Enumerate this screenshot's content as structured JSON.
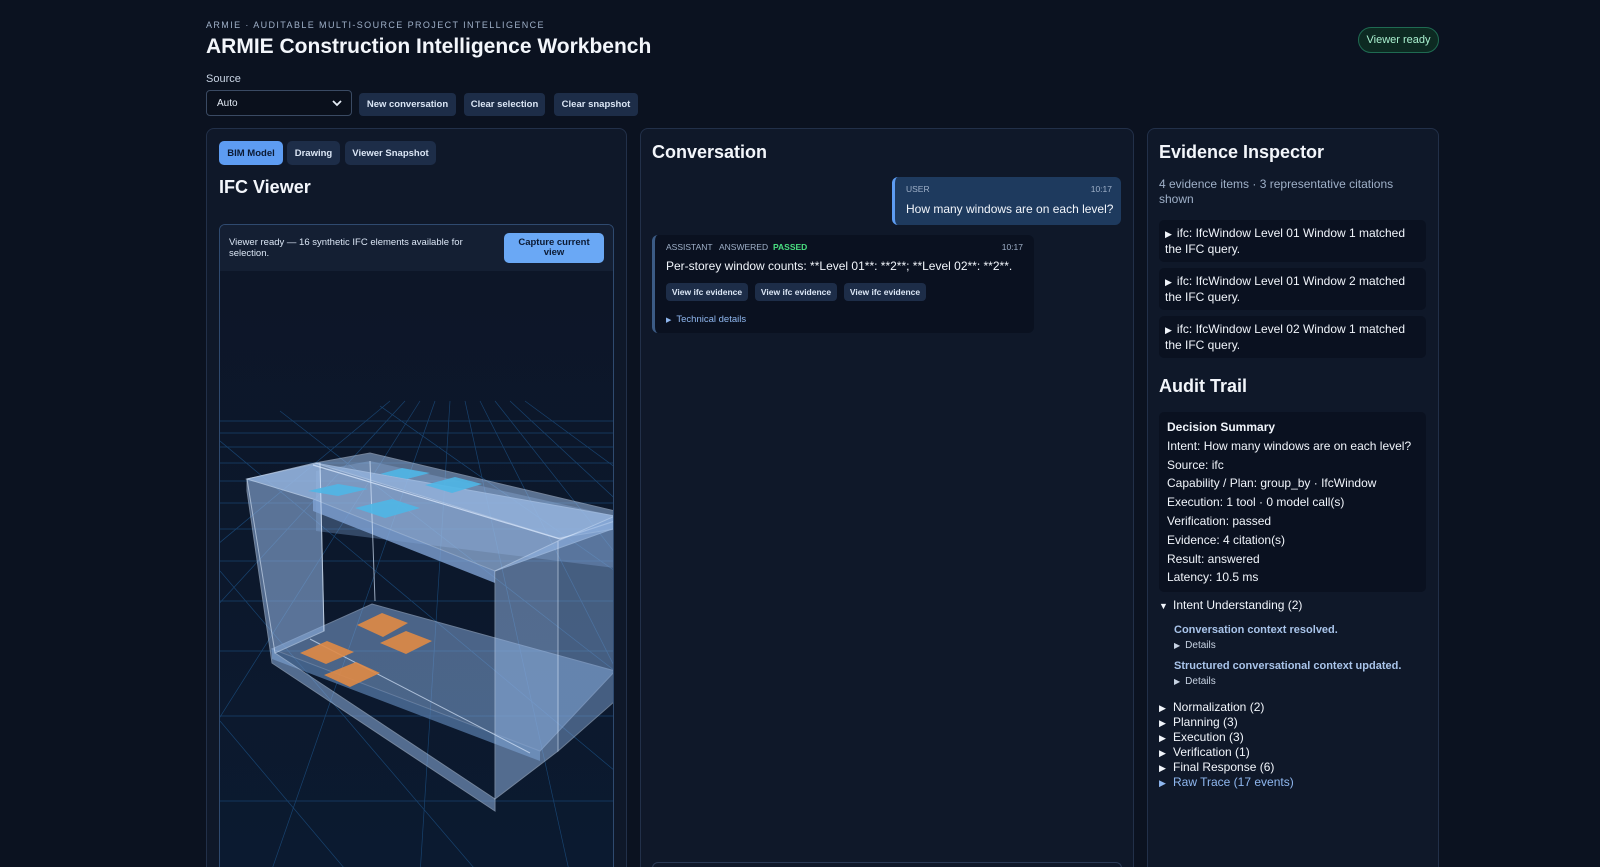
{
  "header": {
    "eyebrow": "ARMIE · AUDITABLE MULTI-SOURCE PROJECT INTELLIGENCE",
    "title": "ARMIE Construction Intelligence Workbench",
    "status": "Viewer ready"
  },
  "toolbar": {
    "source_label": "Source",
    "source_value": "Auto",
    "new_conversation": "New conversation",
    "clear_selection": "Clear selection",
    "clear_snapshot": "Clear snapshot"
  },
  "left_panel": {
    "tabs": [
      {
        "label": "BIM Model",
        "active": true
      },
      {
        "label": "Drawing",
        "active": false
      },
      {
        "label": "Viewer Snapshot",
        "active": false
      }
    ],
    "title": "IFC Viewer",
    "viewer_message": "Viewer ready — 16 synthetic IFC elements available for selection.",
    "capture_button": "Capture current view"
  },
  "conversation": {
    "title": "Conversation",
    "user_message": {
      "role": "USER",
      "time": "10:17",
      "text": "How many windows are on each level?"
    },
    "assistant_message": {
      "role": "ASSISTANT",
      "status": "ANSWERED",
      "verification": "PASSED",
      "time": "10:17",
      "text": "Per-storey window counts: **Level 01**: **2**; **Level 02**: **2**.",
      "evidence_buttons": [
        "View ifc evidence",
        "View ifc evidence",
        "View ifc evidence"
      ],
      "technical_details": "Technical details"
    }
  },
  "evidence": {
    "title": "Evidence Inspector",
    "summary": "4 evidence items · 3 representative citations shown",
    "citations": [
      "ifc: IfcWindow Level 01 Window 1 matched the IFC query.",
      "ifc: IfcWindow Level 01 Window 2 matched the IFC query.",
      "ifc: IfcWindow Level 02 Window 1 matched the IFC query."
    ]
  },
  "audit": {
    "title": "Audit Trail",
    "decision_summary": {
      "heading": "Decision Summary",
      "lines": [
        "Intent: How many windows are on each level?",
        "Source: ifc",
        "Capability / Plan: group_by · IfcWindow",
        "Execution: 1 tool · 0 model call(s)",
        "Verification: passed",
        "Evidence: 4 citation(s)",
        "Result: answered",
        "Latency: 10.5 ms"
      ]
    },
    "intent_section": {
      "label": "Intent Understanding (2)",
      "items": [
        {
          "title": "Conversation context resolved.",
          "details": "Details"
        },
        {
          "title": "Structured conversational context updated.",
          "details": "Details"
        }
      ]
    },
    "sections": [
      "Normalization (2)",
      "Planning (3)",
      "Execution (3)",
      "Verification (1)",
      "Final Response (6)"
    ],
    "raw_trace": "Raw Trace (17 events)"
  },
  "colors": {
    "background": "#0b1220",
    "accent": "#5d9cf2",
    "passed": "#4ade80",
    "panel_border": "#223049"
  },
  "icons": [
    "chevron-down-icon",
    "triangle-right-icon",
    "triangle-down-icon"
  ]
}
